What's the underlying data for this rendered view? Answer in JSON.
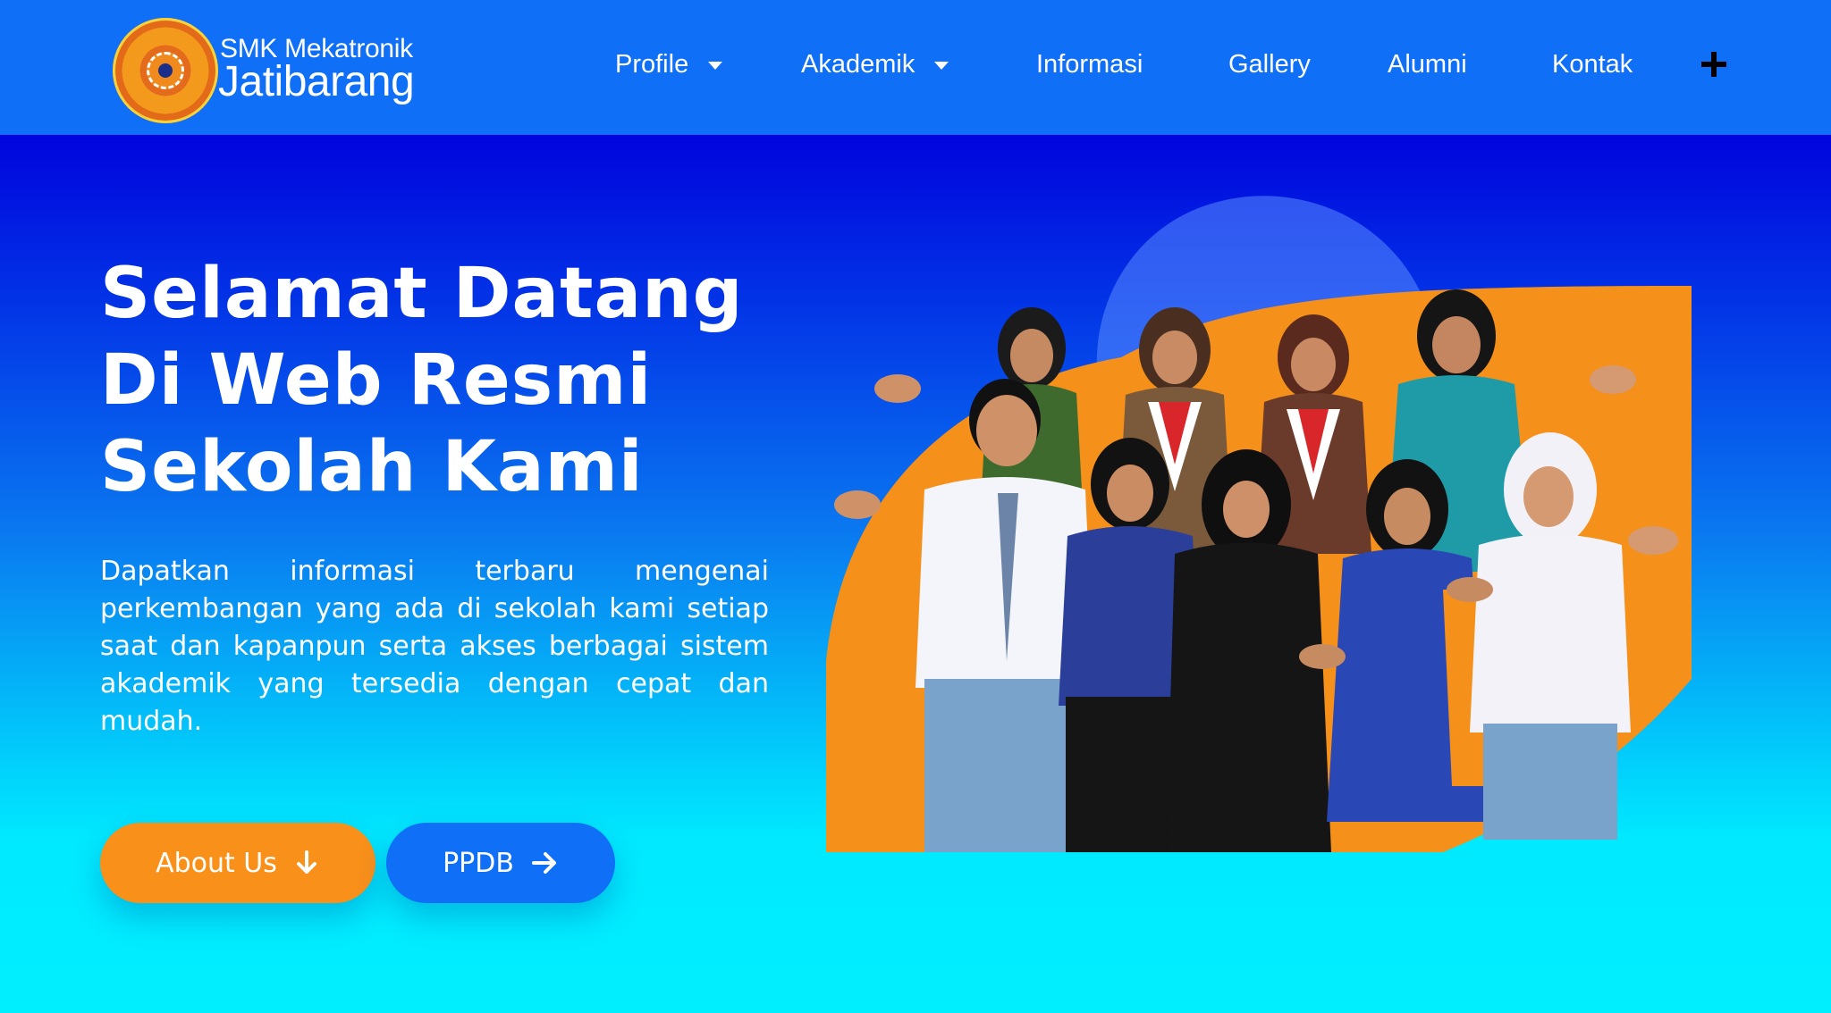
{
  "header": {
    "brand_top": "SMK Mekatronik",
    "brand_main": "Jatibarang",
    "nav": [
      {
        "label": "Profile",
        "has_dropdown": true
      },
      {
        "label": "Akademik",
        "has_dropdown": true
      },
      {
        "label": "Informasi",
        "has_dropdown": false
      },
      {
        "label": "Gallery",
        "has_dropdown": false
      },
      {
        "label": "Alumni",
        "has_dropdown": false
      },
      {
        "label": "Kontak",
        "has_dropdown": false
      }
    ],
    "menu_icon": "plus-icon"
  },
  "hero": {
    "headline": "Selamat Datang Di Web Resmi Sekolah Kami",
    "lead": "Dapatkan informasi terbaru mengenai perkembangan yang ada di sekolah kami setiap saat dan kapanpun serta akses berbagai sistem akademik yang tersedia dengan cepat dan mudah.",
    "buttons": {
      "about_label": "About Us",
      "about_icon": "arrow-down-icon",
      "ppdb_label": "PPDB",
      "ppdb_icon": "arrow-right-icon"
    }
  },
  "colors": {
    "header_bg": "#0f6ff7",
    "hero_top": "#0104dd",
    "hero_bottom": "#00e9ff",
    "accent_orange": "#f8901a",
    "button_blue": "#0f6ff7",
    "text": "#ffffff"
  }
}
